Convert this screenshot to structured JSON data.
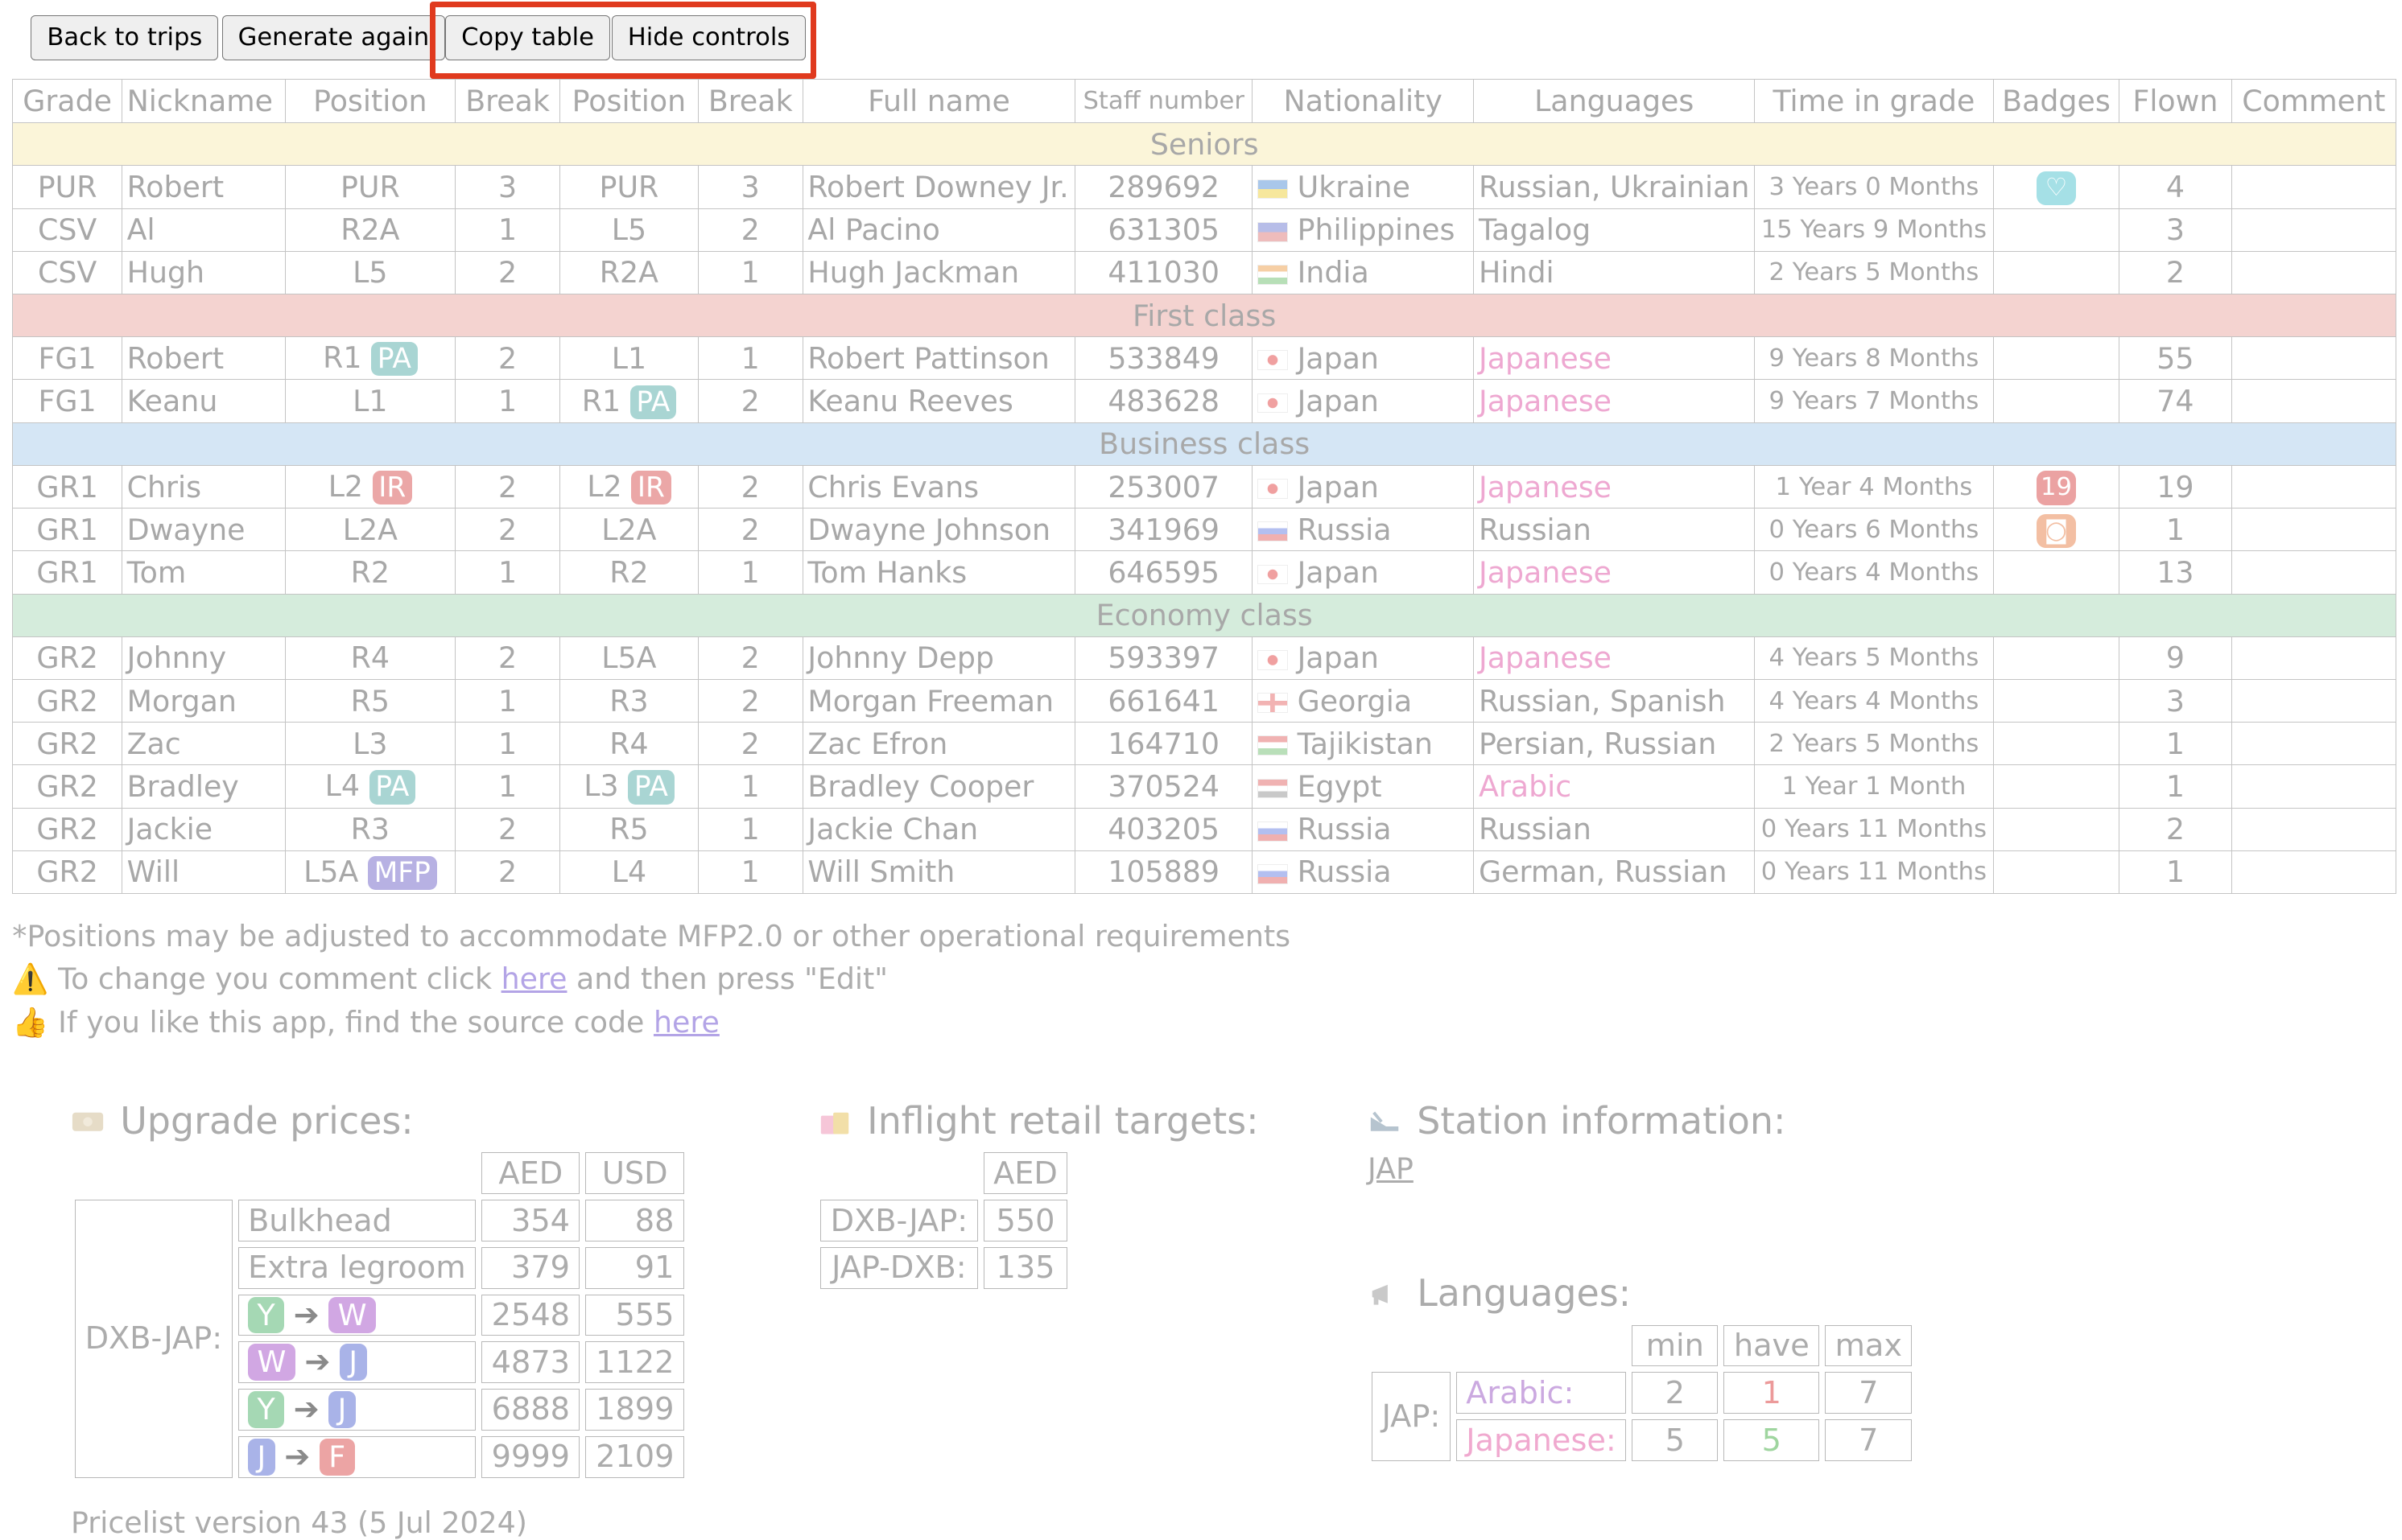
{
  "controls": {
    "back": "Back to trips",
    "generate": "Generate again",
    "copy": "Copy table",
    "hide": "Hide controls"
  },
  "table": {
    "headers": [
      "Grade",
      "Nickname",
      "Position",
      "Break",
      "Position",
      "Break",
      "Full name",
      "Staff number",
      "Nationality",
      "Languages",
      "Time in grade",
      "Badges",
      "Flown",
      "Comment"
    ],
    "sections": {
      "seniors": "Seniors",
      "first": "First class",
      "business": "Business class",
      "economy": "Economy class"
    },
    "rows": [
      {
        "grade": "PUR",
        "nick": "Robert",
        "pos1": "PUR",
        "brk1": "3",
        "pos2": "PUR",
        "brk2": "3",
        "name": "Robert Downey Jr.",
        "staff": "289692",
        "nat": "Ukraine",
        "lang": "Russian, Ukrainian",
        "time": "3 Years 0 Months",
        "flown": "4"
      },
      {
        "grade": "CSV",
        "nick": "Al",
        "pos1": "R2A",
        "brk1": "1",
        "pos2": "L5",
        "brk2": "2",
        "name": "Al Pacino",
        "staff": "631305",
        "nat": "Philippines",
        "lang": "Tagalog",
        "time": "15 Years 9 Months",
        "flown": "3"
      },
      {
        "grade": "CSV",
        "nick": "Hugh",
        "pos1": "L5",
        "brk1": "2",
        "pos2": "R2A",
        "brk2": "1",
        "name": "Hugh Jackman",
        "staff": "411030",
        "nat": "India",
        "lang": "Hindi",
        "time": "2 Years 5 Months",
        "flown": "2"
      },
      {
        "grade": "FG1",
        "nick": "Robert",
        "pos1": "R1",
        "tag1": "PA",
        "brk1": "2",
        "pos2": "L1",
        "brk2": "1",
        "name": "Robert Pattinson",
        "staff": "533849",
        "nat": "Japan",
        "lang": "Japanese",
        "time": "9 Years 8 Months",
        "flown": "55"
      },
      {
        "grade": "FG1",
        "nick": "Keanu",
        "pos1": "L1",
        "brk1": "1",
        "pos2": "R1",
        "tag2": "PA",
        "brk2": "2",
        "name": "Keanu Reeves",
        "staff": "483628",
        "nat": "Japan",
        "lang": "Japanese",
        "time": "9 Years 7 Months",
        "flown": "74"
      },
      {
        "grade": "GR1",
        "nick": "Chris",
        "pos1": "L2",
        "tag1": "IR",
        "brk1": "2",
        "pos2": "L2",
        "tag2": "IR",
        "brk2": "2",
        "name": "Chris Evans",
        "staff": "253007",
        "nat": "Japan",
        "lang": "Japanese",
        "time": "1 Year 4 Months",
        "badge": "19",
        "flown": "19"
      },
      {
        "grade": "GR1",
        "nick": "Dwayne",
        "pos1": "L2A",
        "brk1": "2",
        "pos2": "L2A",
        "brk2": "2",
        "name": "Dwayne Johnson",
        "staff": "341969",
        "nat": "Russia",
        "lang": "Russian",
        "time": "0 Years 6 Months",
        "flown": "1"
      },
      {
        "grade": "GR1",
        "nick": "Tom",
        "pos1": "R2",
        "brk1": "1",
        "pos2": "R2",
        "brk2": "1",
        "name": "Tom Hanks",
        "staff": "646595",
        "nat": "Japan",
        "lang": "Japanese",
        "time": "0 Years 4 Months",
        "flown": "13"
      },
      {
        "grade": "GR2",
        "nick": "Johnny",
        "pos1": "R4",
        "brk1": "2",
        "pos2": "L5A",
        "brk2": "2",
        "name": "Johnny Depp",
        "staff": "593397",
        "nat": "Japan",
        "lang": "Japanese",
        "time": "4 Years 5 Months",
        "flown": "9"
      },
      {
        "grade": "GR2",
        "nick": "Morgan",
        "pos1": "R5",
        "brk1": "1",
        "pos2": "R3",
        "brk2": "2",
        "name": "Morgan Freeman",
        "staff": "661641",
        "nat": "Georgia",
        "lang": "Russian, Spanish",
        "time": "4 Years 4 Months",
        "flown": "3"
      },
      {
        "grade": "GR2",
        "nick": "Zac",
        "pos1": "L3",
        "brk1": "1",
        "pos2": "R4",
        "brk2": "2",
        "name": "Zac Efron",
        "staff": "164710",
        "nat": "Tajikistan",
        "lang": "Persian, Russian",
        "time": "2 Years 5 Months",
        "flown": "1"
      },
      {
        "grade": "GR2",
        "nick": "Bradley",
        "pos1": "L4",
        "tag1": "PA",
        "brk1": "1",
        "pos2": "L3",
        "tag2": "PA",
        "brk2": "1",
        "name": "Bradley Cooper",
        "staff": "370524",
        "nat": "Egypt",
        "lang": "Arabic",
        "time": "1 Year 1 Month",
        "flown": "1"
      },
      {
        "grade": "GR2",
        "nick": "Jackie",
        "pos1": "R3",
        "brk1": "2",
        "pos2": "R5",
        "brk2": "1",
        "name": "Jackie Chan",
        "staff": "403205",
        "nat": "Russia",
        "lang": "Russian",
        "time": "0 Years 11 Months",
        "flown": "2"
      },
      {
        "grade": "GR2",
        "nick": "Will",
        "pos1": "L5A",
        "tag1": "MFP",
        "brk1": "2",
        "pos2": "L4",
        "brk2": "1",
        "name": "Will Smith",
        "staff": "105889",
        "nat": "Russia",
        "lang": "German, Russian",
        "time": "0 Years 11 Months",
        "flown": "1"
      }
    ]
  },
  "notes": {
    "footnote": "*Positions may be adjusted to accommodate MFP2.0 or other operational requirements",
    "comment_prefix": "To change you comment click",
    "comment_link": "here",
    "comment_suffix": "and then press \"Edit\"",
    "source_prefix": "If you like this app, find the source code",
    "source_link": "here"
  },
  "upgrade": {
    "title": "Upgrade prices:",
    "col_aed": "AED",
    "col_usd": "USD",
    "route": "DXB-JAP:",
    "rows": [
      {
        "label": "Bulkhead",
        "aed": "354",
        "usd": "88"
      },
      {
        "label": "Extra legroom",
        "aed": "379",
        "usd": "91"
      },
      {
        "from": "Y",
        "to": "W",
        "aed": "2548",
        "usd": "555"
      },
      {
        "from": "W",
        "to": "J",
        "aed": "4873",
        "usd": "1122"
      },
      {
        "from": "Y",
        "to": "J",
        "aed": "6888",
        "usd": "1899"
      },
      {
        "from": "J",
        "to": "F",
        "aed": "9999",
        "usd": "2109"
      }
    ],
    "arrow": "➔",
    "pricelist": "Pricelist version 43 (5 Jul 2024)"
  },
  "retail": {
    "title": "Inflight retail targets:",
    "col_aed": "AED",
    "rows": [
      {
        "route": "DXB-JAP:",
        "aed": "550"
      },
      {
        "route": "JAP-DXB:",
        "aed": "135"
      }
    ]
  },
  "station": {
    "title": "Station information:",
    "link": "JAP"
  },
  "languages": {
    "title": "Languages:",
    "col_min": "min",
    "col_have": "have",
    "col_max": "max",
    "station": "JAP:",
    "rows": [
      {
        "lang": "Arabic:",
        "min": "2",
        "have": "1",
        "max": "7"
      },
      {
        "lang": "Japanese:",
        "min": "5",
        "have": "5",
        "max": "7"
      }
    ]
  },
  "colors": {
    "seniors": "#fbf5d9",
    "first": "#f4d3d0",
    "business": "#d5e6f5",
    "economy": "#d5ecdc",
    "highlight": "#e03a1e"
  }
}
